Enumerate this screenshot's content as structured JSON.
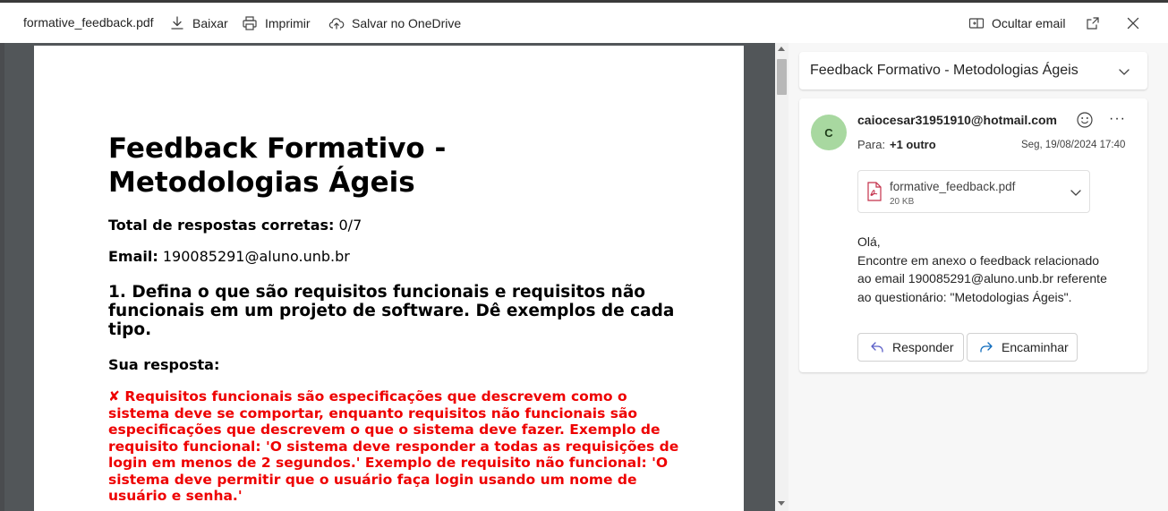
{
  "toolbar": {
    "filename": "formative_feedback.pdf",
    "download_label": "Baixar",
    "print_label": "Imprimir",
    "save_onedrive_label": "Salvar no OneDrive",
    "hide_email_label": "Ocultar email"
  },
  "pdf": {
    "title": "Feedback Formativo - Metodologias Ágeis",
    "total_label": "Total de respostas corretas:",
    "total_value": "0/7",
    "email_label": "Email:",
    "email_value": "190085291@aluno.unb.br",
    "question": "1. Defina o que são requisitos funcionais e requisitos não funcionais em um projeto de software. Dê exemplos de cada tipo.",
    "answer_label": "Sua resposta:",
    "answer_text": "✘ Requisitos funcionais são especificações que descrevem como o sistema deve se comportar, enquanto requisitos não funcionais são especificações que descrevem o que o sistema deve fazer. Exemplo de requisito funcional: 'O sistema deve responder a todas as requisições de login em menos de 2 segundos.' Exemplo de requisito não funcional: 'O sistema deve permitir que o usuário faça login usando um nome de usuário e senha.'",
    "answer_color": "#ee0000"
  },
  "email": {
    "subject": "Feedback Formativo - Metodologias Ágeis",
    "avatar_letter": "C",
    "avatar_color": "#a8d8a0",
    "sender": "caiocesar31951910@hotmail.com",
    "to_label": "Para:",
    "to_value": "+1 outro",
    "date": "Seg, 19/08/2024 17:40",
    "attachment": {
      "name": "formative_feedback.pdf",
      "size": "20 KB"
    },
    "body": {
      "greeting": "Olá,",
      "line1": "Encontre em anexo o feedback relacionado",
      "line2": "ao email 190085291@aluno.unb.br referente",
      "line3": "ao questionário: \"Metodologias Ágeis\"."
    },
    "reply_label": "Responder",
    "forward_label": "Encaminhar",
    "accent_color": "#0f6cbd"
  }
}
